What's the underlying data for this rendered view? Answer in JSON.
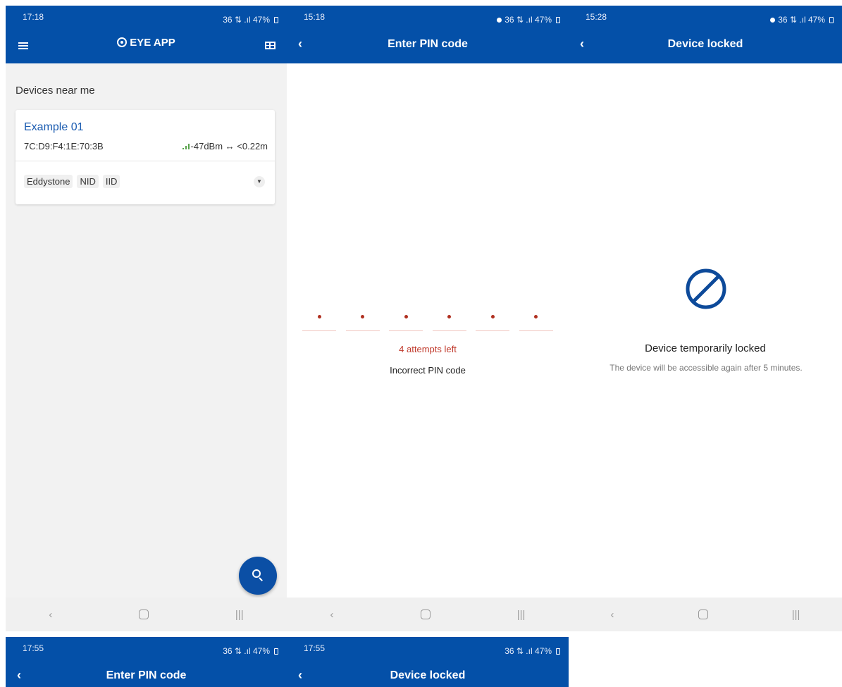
{
  "screen1": {
    "status_time": "17:18",
    "status_right": "36 ⇅ .ıl 47%",
    "brand": "EYE APP",
    "section_title": "Devices near me",
    "device": {
      "name": "Example 01",
      "mac": "7C:D9:F4:1E:70:3B",
      "signal": "-47dBm ↔ <0.22m",
      "tags": [
        "Eddystone",
        "NID",
        "IID"
      ]
    }
  },
  "screen2": {
    "status_time": "15:18",
    "status_right": "36 ⇅ .ıl 47%",
    "title": "Enter PIN code",
    "attempts": "4 attempts left",
    "error": "Incorrect PIN code"
  },
  "screen3": {
    "status_time": "15:28",
    "status_right": "36 ⇅ .ıl 47%",
    "title": "Device locked",
    "lock_title": "Device temporarily locked",
    "lock_body": "The device will be accessible again after 5 minutes."
  },
  "screen4": {
    "status_time": "17:55",
    "status_right": "36 ⇅ .ıl 47%",
    "title": "Enter PIN code"
  },
  "screen5": {
    "status_time": "17:55",
    "status_right": "36 ⇅ .ıl 47%",
    "title": "Device locked"
  },
  "nav": {
    "back": "‹",
    "recents": "|||"
  },
  "colors": {
    "primary": "#0450a8",
    "error": "#c0392b",
    "accent_blue": "#1a5bb0"
  }
}
